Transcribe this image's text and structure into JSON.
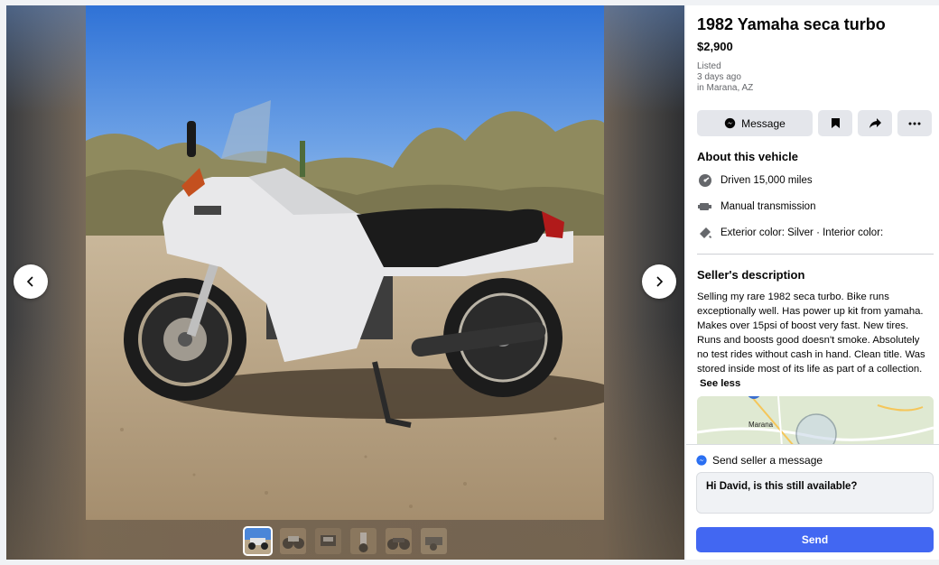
{
  "listing": {
    "title": "1982 Yamaha seca turbo",
    "price": "$2,900",
    "listed_label": "Listed",
    "listed_time": "3 days ago",
    "location": "in Marana, AZ"
  },
  "actions": {
    "message_label": "Message",
    "save_icon": "bookmark-icon",
    "share_icon": "share-icon",
    "more_icon": "more-icon"
  },
  "vehicle": {
    "heading": "About this vehicle",
    "items": [
      {
        "icon": "speedometer-icon",
        "text": "Driven 15,000 miles"
      },
      {
        "icon": "transmission-icon",
        "text": "Manual transmission"
      },
      {
        "icon": "paint-icon",
        "text": "Exterior color: Silver · Interior color:"
      }
    ]
  },
  "seller": {
    "heading": "Seller's description",
    "description": "Selling my rare 1982 seca turbo. Bike runs exceptionally well. Has power up kit from yamaha. Makes over 15psi of boost very fast. New tires. Runs and boosts good doesn't smoke. Absolutely no test rides without cash in hand. Clean title. Was stored inside most of its life as part of a collection.",
    "see_less": "See less"
  },
  "map": {
    "city_label": "Marana"
  },
  "send": {
    "heading": "Send seller a message",
    "message_value": "Hi David, is this still available?",
    "send_label": "Send"
  },
  "gallery": {
    "thumbnail_count": 6,
    "active_index": 0
  },
  "colors": {
    "accent": "#4267f2",
    "button_gray": "#e4e6eb",
    "text": "#050505",
    "muted": "#65676b"
  }
}
